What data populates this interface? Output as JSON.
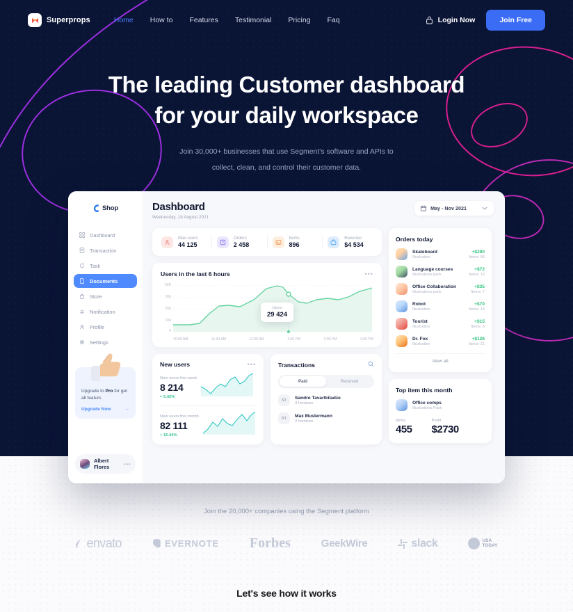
{
  "nav": {
    "brand": "Superprops",
    "brand_icon": "bowtie-logo-icon",
    "links": [
      {
        "label": "Home",
        "active": true
      },
      {
        "label": "How to",
        "active": false
      },
      {
        "label": "Features",
        "active": false
      },
      {
        "label": "Testimonial",
        "active": false
      },
      {
        "label": "Pricing",
        "active": false
      },
      {
        "label": "Faq",
        "active": false
      }
    ],
    "login_label": "Login Now",
    "login_icon": "lock-icon",
    "join_label": "Join Free",
    "accent": "#3b6cf6"
  },
  "hero": {
    "title_line1": "The leading Customer dashboard",
    "title_line2": "for your daily workspace",
    "sub_line1": "Join 30,000+ businesses that use Segment's software and APIs to",
    "sub_line2": "collect, clean, and control their customer data.",
    "bg_color": "#0a1435",
    "deco_left_color": "#9b2fe0",
    "deco_right_color": "#d61f8f"
  },
  "dashboard": {
    "shop_logo": "Shop",
    "sidebar": [
      {
        "label": "Dashboard",
        "icon": "grid-icon",
        "active": false
      },
      {
        "label": "Transaction",
        "icon": "receipt-icon",
        "active": false
      },
      {
        "label": "Task",
        "icon": "refresh-icon",
        "active": false
      },
      {
        "label": "Documents",
        "icon": "document-icon",
        "active": true
      },
      {
        "label": "Store",
        "icon": "bag-icon",
        "active": false
      },
      {
        "label": "Notification",
        "icon": "bell-icon",
        "active": false
      },
      {
        "label": "Profile",
        "icon": "person-icon",
        "active": false
      },
      {
        "label": "Settings",
        "icon": "gear-icon",
        "active": false
      }
    ],
    "upgrade": {
      "text_pre": "Upgrade to ",
      "text_bold": "Pro",
      "text_post": " for get all featurs",
      "link": "Upgrade Now",
      "arrow": "→",
      "image": "thumbs-up-icon"
    },
    "user": {
      "name": "Albert Flores",
      "menu": "•••",
      "avatar": "user-avatar"
    },
    "header": {
      "title": "Dashboard",
      "date": "Wednesday, 18 August 2021",
      "picker_label": "May - Nov 2021",
      "picker_icon": "calendar-icon",
      "chevron": "chevron-down-icon"
    },
    "stats": [
      {
        "key": "Max users",
        "value": "44 125",
        "icon": "user-icon",
        "color": "#f59b9b",
        "bg": "#fde7e5"
      },
      {
        "key": "Orders",
        "value": "2 458",
        "icon": "box-icon",
        "color": "#8a7bf2",
        "bg": "#e9e6fd"
      },
      {
        "key": "Items",
        "value": "896",
        "icon": "image-icon",
        "color": "#f0a96a",
        "bg": "#fdeedd"
      },
      {
        "key": "Revenue",
        "value": "$4 534",
        "icon": "briefcase-icon",
        "color": "#57a7f5",
        "bg": "#dcecfd"
      }
    ],
    "chart": {
      "title": "Users in the last 6 hours",
      "menu": "•••",
      "tooltip_key": "Users",
      "tooltip_value": "29 424"
    },
    "new_users": {
      "title": "New users",
      "menu": "•••",
      "week_key": "New users this week",
      "week_value": "8 214",
      "week_delta": "+ 5.42%",
      "month_key": "New users this month",
      "month_value": "82 111",
      "month_delta": "+ 15.44%"
    },
    "transactions": {
      "title": "Transactions",
      "search_icon": "search-icon",
      "tabs": [
        {
          "label": "Paid",
          "active": true
        },
        {
          "label": "Received",
          "active": false
        }
      ],
      "rows": [
        {
          "initials": "ST",
          "name": "Sandro Tavartkiladze",
          "sub": "3 Invoices"
        },
        {
          "initials": "ST",
          "name": "Max Mustermann",
          "sub": "2 Invoices"
        }
      ]
    },
    "orders": {
      "title": "Orders today",
      "view_all": "View all",
      "rows": [
        {
          "name": "Skateboard",
          "sub": "Illustration",
          "price": "+$290",
          "items": "Items: 58",
          "c1": "#ffd9b8",
          "c2": "#5aa2e8"
        },
        {
          "name": "Language courses",
          "sub": "Illustrations pack",
          "price": "+$72",
          "items": "Items: 12",
          "c1": "#b9e6b0",
          "c2": "#3f4f66"
        },
        {
          "name": "Office Collaboration",
          "sub": "Illustrations pack",
          "price": "+$35",
          "items": "Items: 7",
          "c1": "#ffe0c6",
          "c2": "#f29a7a"
        },
        {
          "name": "Robot",
          "sub": "Illustration",
          "price": "+$70",
          "items": "Items: 14",
          "c1": "#cde4fb",
          "c2": "#5b93de"
        },
        {
          "name": "Tourist",
          "sub": "Illustration",
          "price": "+$15",
          "items": "Items: 3",
          "c1": "#f7b9b3",
          "c2": "#e2463c"
        },
        {
          "name": "Dr. Fox",
          "sub": "Illustration",
          "price": "+$126",
          "items": "Items: 21",
          "c1": "#ffd9a8",
          "c2": "#e8731f"
        }
      ]
    },
    "top_item": {
      "title": "Top item this month",
      "name": "Office comps",
      "sub": "Illustrations Pack",
      "items_key": "Items",
      "items_value": "455",
      "profit_key": "Profit",
      "profit_value": "$2730"
    }
  },
  "logos_section": {
    "caption": "Join the 20,000+ companies using the Segment platform",
    "logos": [
      {
        "name": "envato"
      },
      {
        "name": "EVERNOTE"
      },
      {
        "name": "Forbes"
      },
      {
        "name": "GeekWire"
      },
      {
        "name": "slack"
      },
      {
        "name": "USA TODAY",
        "line1": "USA",
        "line2": "TODAY"
      }
    ]
  },
  "works_section": {
    "title": "Let's see how it works"
  },
  "chart_data": {
    "type": "area",
    "title": "Users in the last 6 hours",
    "xlabel": "",
    "ylabel": "Users",
    "categories": [
      "10:00 AM",
      "11:00 AM",
      "12:00 AM",
      "1:00 PM",
      "2:00 PM",
      "3:00 PM"
    ],
    "ytick_labels": [
      "0",
      "10k",
      "20k",
      "30k",
      "60K"
    ],
    "ylim": [
      0,
      65000
    ],
    "grid": true,
    "legend": "none",
    "series": [
      {
        "name": "Users",
        "x": [
          "09:45 AM",
          "10:00 AM",
          "10:20 AM",
          "10:40 AM",
          "11:00 AM",
          "11:20 AM",
          "11:40 AM",
          "12:00 AM",
          "12:20 PM",
          "12:40 PM",
          "1:00 PM",
          "1:20 PM",
          "1:40 PM",
          "2:00 PM",
          "2:20 PM",
          "2:40 PM",
          "3:00 PM"
        ],
        "values": [
          9000,
          9200,
          12000,
          21000,
          25500,
          25000,
          26000,
          34000,
          52000,
          56000,
          29424,
          27000,
          26500,
          32000,
          34000,
          31000,
          37000
        ],
        "color": "#5ed39a",
        "fill": "#d9f2e4"
      }
    ],
    "annotation": {
      "label": "Users",
      "value": "29 424",
      "at_x": "1:00 PM"
    },
    "new_users_sparklines": [
      {
        "name": "New users this week",
        "value": 8214,
        "delta_pct": 5.42,
        "values": [
          42,
          30,
          18,
          34,
          48,
          40,
          56,
          62,
          44,
          50,
          70,
          82
        ],
        "color": "#2fc7c0"
      },
      {
        "name": "New users this month",
        "value": 82111,
        "delta_pct": 15.44,
        "values": [
          8,
          22,
          46,
          30,
          56,
          40,
          34,
          58,
          72,
          54,
          78,
          92
        ],
        "color": "#2fc7c0"
      }
    ]
  }
}
